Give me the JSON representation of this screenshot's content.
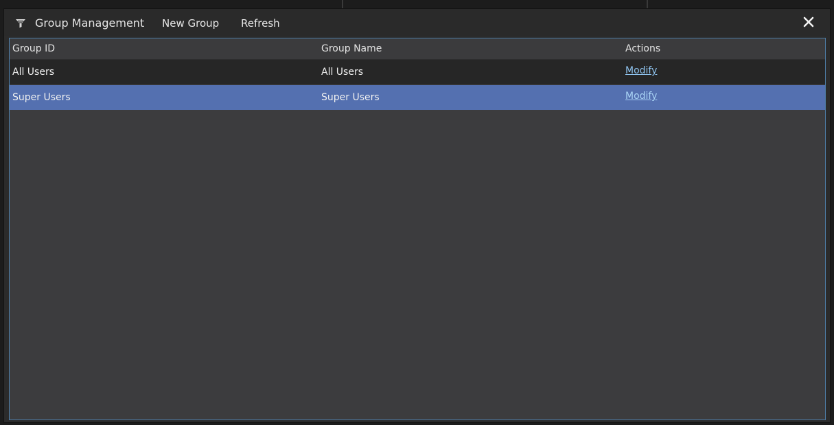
{
  "titlebar": {
    "app_icon": "filter-funnel-icon",
    "title": "Group Management",
    "menu": [
      {
        "label": "New Group"
      },
      {
        "label": "Refresh"
      }
    ],
    "close_icon": "close-icon"
  },
  "table": {
    "columns": [
      "Group ID",
      "Group Name",
      "Actions"
    ],
    "rows": [
      {
        "group_id": "All Users",
        "group_name": "All Users",
        "action": "Modify",
        "selected": false
      },
      {
        "group_id": "Super Users",
        "group_name": "Super Users",
        "action": "Modify",
        "selected": true
      }
    ]
  },
  "colors": {
    "accent_border": "#4e7ea8",
    "selected_row": "#5470b0",
    "link": "#8fc3ee"
  }
}
